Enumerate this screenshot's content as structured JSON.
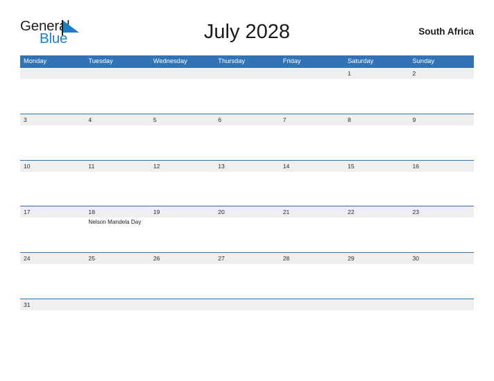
{
  "brand": {
    "name_part1": "General",
    "name_part2": "Blue",
    "flag_icon": "blue-triangle-flag-icon",
    "accent_color": "#1b7fc4"
  },
  "header": {
    "title": "July 2028",
    "country": "South Africa"
  },
  "calendar": {
    "month": "July",
    "year": "2028",
    "header_bg": "#3173b5",
    "band_bg": "#efefef",
    "separator_color": "#2f6fb0",
    "weekdays": [
      "Monday",
      "Tuesday",
      "Wednesday",
      "Thursday",
      "Friday",
      "Saturday",
      "Sunday"
    ],
    "weeks": [
      {
        "days": [
          {
            "num": "",
            "event": ""
          },
          {
            "num": "",
            "event": ""
          },
          {
            "num": "",
            "event": ""
          },
          {
            "num": "",
            "event": ""
          },
          {
            "num": "",
            "event": ""
          },
          {
            "num": "1",
            "event": ""
          },
          {
            "num": "2",
            "event": ""
          }
        ]
      },
      {
        "days": [
          {
            "num": "3",
            "event": ""
          },
          {
            "num": "4",
            "event": ""
          },
          {
            "num": "5",
            "event": ""
          },
          {
            "num": "6",
            "event": ""
          },
          {
            "num": "7",
            "event": ""
          },
          {
            "num": "8",
            "event": ""
          },
          {
            "num": "9",
            "event": ""
          }
        ]
      },
      {
        "days": [
          {
            "num": "10",
            "event": ""
          },
          {
            "num": "11",
            "event": ""
          },
          {
            "num": "12",
            "event": ""
          },
          {
            "num": "13",
            "event": ""
          },
          {
            "num": "14",
            "event": ""
          },
          {
            "num": "15",
            "event": ""
          },
          {
            "num": "16",
            "event": ""
          }
        ]
      },
      {
        "days": [
          {
            "num": "17",
            "event": ""
          },
          {
            "num": "18",
            "event": "Nelson Mandela Day"
          },
          {
            "num": "19",
            "event": ""
          },
          {
            "num": "20",
            "event": ""
          },
          {
            "num": "21",
            "event": ""
          },
          {
            "num": "22",
            "event": ""
          },
          {
            "num": "23",
            "event": ""
          }
        ]
      },
      {
        "days": [
          {
            "num": "24",
            "event": ""
          },
          {
            "num": "25",
            "event": ""
          },
          {
            "num": "26",
            "event": ""
          },
          {
            "num": "27",
            "event": ""
          },
          {
            "num": "28",
            "event": ""
          },
          {
            "num": "29",
            "event": ""
          },
          {
            "num": "30",
            "event": ""
          }
        ]
      },
      {
        "days": [
          {
            "num": "31",
            "event": ""
          },
          {
            "num": "",
            "event": ""
          },
          {
            "num": "",
            "event": ""
          },
          {
            "num": "",
            "event": ""
          },
          {
            "num": "",
            "event": ""
          },
          {
            "num": "",
            "event": ""
          },
          {
            "num": "",
            "event": ""
          }
        ]
      }
    ]
  }
}
